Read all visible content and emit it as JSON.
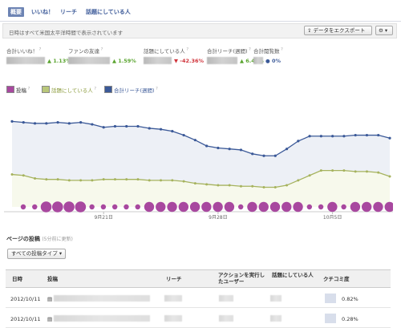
{
  "tabs": [
    "概要",
    "いいね！",
    "リーチ",
    "話題にしている人"
  ],
  "toolbar": {
    "timezone_note": "日時はすべて米国太平洋時間で表示されています",
    "export_label": "データをエクスポート",
    "gear_label": "⚙ ▾"
  },
  "metrics": [
    {
      "label": "合計いいね！",
      "delta": "1.13%",
      "dir": "up"
    },
    {
      "label": "ファンの友達",
      "delta": "1.59%",
      "dir": "up"
    },
    {
      "label": "話題にしている人",
      "delta": "-42.36%",
      "dir": "down"
    },
    {
      "label": "合計リーチ(週間)",
      "delta": "6.46%",
      "dir": "up"
    },
    {
      "label": "合計閲覧数",
      "delta": "0%",
      "dir": "zero"
    }
  ],
  "legend": [
    {
      "label": "投稿",
      "color": "#a8489f"
    },
    {
      "label": "話題にしている人",
      "color": "#b9c77a"
    },
    {
      "label": "合計リーチ(週間)",
      "color": "#3b5998"
    }
  ],
  "chart_data": {
    "type": "line",
    "x_ticks": [
      "9月21日",
      "9月28日",
      "10月5日"
    ],
    "series": [
      {
        "name": "合計リーチ(週間)",
        "values": [
          0.87,
          0.86,
          0.85,
          0.85,
          0.86,
          0.85,
          0.86,
          0.84,
          0.81,
          0.82,
          0.82,
          0.82,
          0.8,
          0.79,
          0.77,
          0.73,
          0.68,
          0.62,
          0.6,
          0.59,
          0.58,
          0.54,
          0.52,
          0.52,
          0.59,
          0.67,
          0.72,
          0.72,
          0.72,
          0.72,
          0.73,
          0.73,
          0.73,
          0.7
        ]
      },
      {
        "name": "話題にしている人",
        "values": [
          0.33,
          0.32,
          0.29,
          0.28,
          0.28,
          0.27,
          0.27,
          0.27,
          0.28,
          0.28,
          0.28,
          0.28,
          0.27,
          0.27,
          0.27,
          0.26,
          0.24,
          0.23,
          0.22,
          0.22,
          0.21,
          0.21,
          0.2,
          0.2,
          0.22,
          0.27,
          0.32,
          0.37,
          0.37,
          0.37,
          0.36,
          0.36,
          0.35,
          0.31
        ]
      },
      {
        "name": "投稿",
        "bubbles": [
          0.2,
          0.2,
          0.8,
          0.8,
          0.8,
          0.8,
          0.2,
          0.2,
          0.2,
          0.2,
          0.2,
          0.7,
          0.7,
          0.7,
          0.7,
          0.7,
          0.7,
          0.7,
          0.7,
          0.2,
          0.7,
          0.7,
          0.7,
          0.7,
          0.7,
          0.2,
          0.2,
          0.7,
          0.2,
          0.7,
          0.7,
          0.7,
          0.7,
          0.7
        ]
      }
    ]
  },
  "posts": {
    "title": "ページの投稿",
    "updated_note": "(5分前に更新)",
    "filter_label": "すべての投稿タイプ ▾",
    "columns": [
      "日時",
      "投稿",
      "リーチ",
      "アクションを実行したユーザー",
      "話題にしている人",
      "クチコミ度"
    ],
    "rows": [
      {
        "date": "2012/10/11",
        "virality": "0.82%"
      },
      {
        "date": "2012/10/11",
        "virality": "0.28%"
      }
    ]
  }
}
